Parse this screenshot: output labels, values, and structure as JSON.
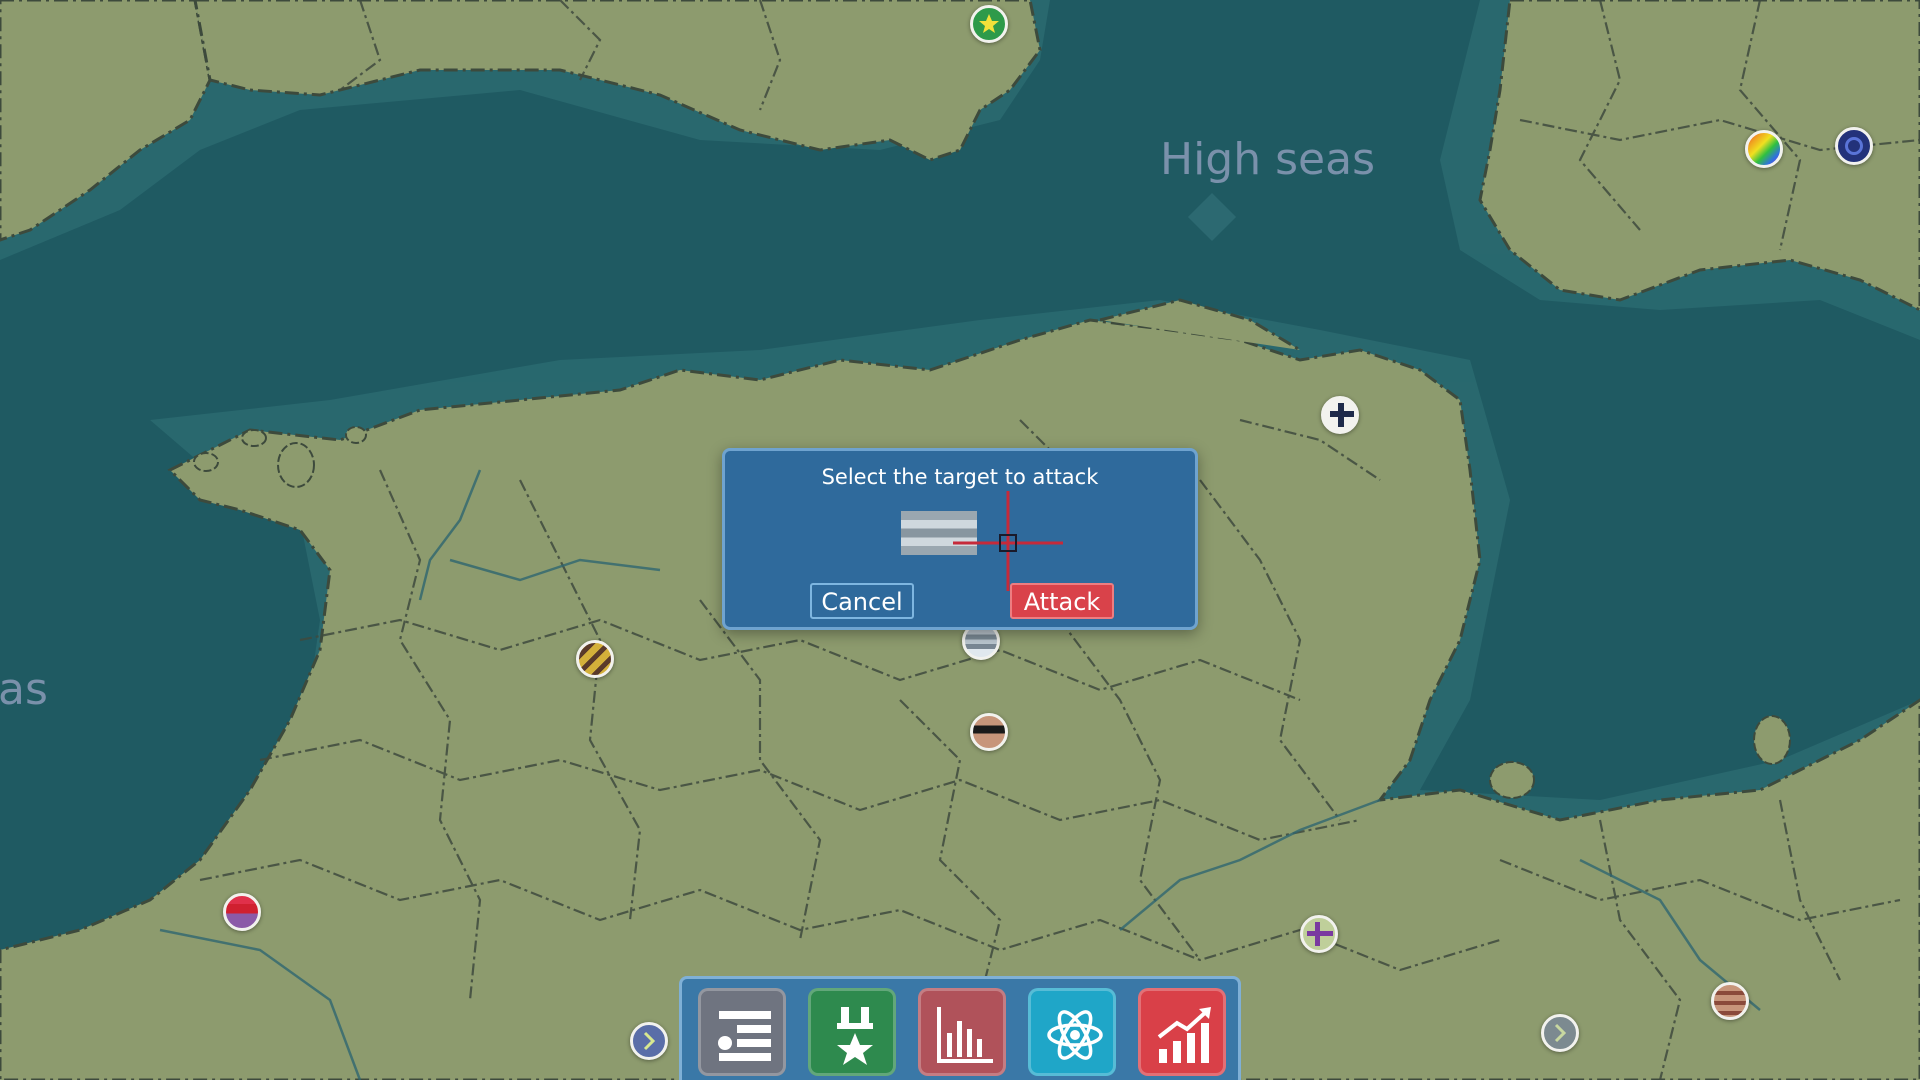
{
  "map": {
    "sea_labels": {
      "high_seas": "High seas",
      "left_partial": "as"
    }
  },
  "dialog": {
    "title": "Select the target to attack",
    "cancel_label": "Cancel",
    "attack_label": "Attack",
    "target_icon": "target-flag-icon",
    "crosshair_icon": "crosshair-icon"
  },
  "toolbar": {
    "buttons": [
      {
        "name": "list-menu-icon",
        "color": "#6f7480"
      },
      {
        "name": "military-rank-icon",
        "color": "#2e8a4e"
      },
      {
        "name": "statistics-bar-chart-icon",
        "color": "#b0525a"
      },
      {
        "name": "research-atom-icon",
        "color": "#1fa6c8"
      },
      {
        "name": "economy-growth-icon",
        "color": "#d94048"
      }
    ]
  },
  "colors": {
    "sea": "#1f5a62",
    "land": "#8d9b6e",
    "dialog_bg": "#2f6a9c",
    "attack": "#d9424a",
    "toolbar_bg": "#3a78a7"
  }
}
